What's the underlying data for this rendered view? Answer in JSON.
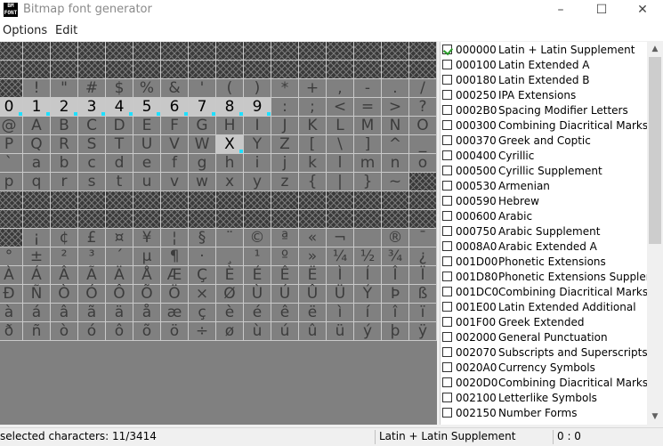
{
  "window": {
    "title": "Bitmap font generator",
    "icon_text": "BM FONT",
    "min_icon": "–",
    "max_icon": "☐",
    "close_icon": "✕"
  },
  "menu": [
    "Options",
    "Edit"
  ],
  "grid": {
    "rows": [
      [
        "",
        "",
        "",
        "",
        "",
        "",
        "",
        "",
        "",
        "",
        "",
        "",
        "",
        "",
        "",
        ""
      ],
      [
        "",
        "",
        "",
        "",
        "",
        "",
        "",
        "",
        "",
        "",
        "",
        "",
        "",
        "",
        "",
        ""
      ],
      [
        "",
        "!",
        "\"",
        "#",
        "$",
        "%",
        "&",
        "'",
        "(",
        ")",
        "*",
        "+",
        ",",
        "-",
        ".",
        "/"
      ],
      [
        "0",
        "1",
        "2",
        "3",
        "4",
        "5",
        "6",
        "7",
        "8",
        "9",
        ":",
        ";",
        "<",
        "=",
        ">",
        "?"
      ],
      [
        "@",
        "A",
        "B",
        "C",
        "D",
        "E",
        "F",
        "G",
        "H",
        "I",
        "J",
        "K",
        "L",
        "M",
        "N",
        "O"
      ],
      [
        "P",
        "Q",
        "R",
        "S",
        "T",
        "U",
        "V",
        "W",
        "X",
        "Y",
        "Z",
        "[",
        "\\",
        "]",
        "^",
        "_"
      ],
      [
        "`",
        "a",
        "b",
        "c",
        "d",
        "e",
        "f",
        "g",
        "h",
        "i",
        "j",
        "k",
        "l",
        "m",
        "n",
        "o"
      ],
      [
        "p",
        "q",
        "r",
        "s",
        "t",
        "u",
        "v",
        "w",
        "x",
        "y",
        "z",
        "{",
        "|",
        "}",
        "~",
        ""
      ],
      [
        "",
        "",
        "",
        "",
        "",
        "",
        "",
        "",
        "",
        "",
        "",
        "",
        "",
        "",
        "",
        ""
      ],
      [
        "",
        "",
        "",
        "",
        "",
        "",
        "",
        "",
        "",
        "",
        "",
        "",
        "",
        "",
        "",
        ""
      ],
      [
        "",
        "¡",
        "¢",
        "£",
        "¤",
        "¥",
        "¦",
        "§",
        "¨",
        "©",
        "ª",
        "«",
        "¬",
        "",
        "®",
        "¯"
      ],
      [
        "°",
        "±",
        "²",
        "³",
        "´",
        "µ",
        "¶",
        "·",
        "¸",
        "¹",
        "º",
        "»",
        "¼",
        "½",
        "¾",
        "¿"
      ],
      [
        "À",
        "Á",
        "Â",
        "Ã",
        "Ä",
        "Å",
        "Æ",
        "Ç",
        "È",
        "É",
        "Ê",
        "Ë",
        "Ì",
        "Í",
        "Î",
        "Ï"
      ],
      [
        "Ð",
        "Ñ",
        "Ò",
        "Ó",
        "Ô",
        "Õ",
        "Ö",
        "×",
        "Ø",
        "Ù",
        "Ú",
        "Û",
        "Ü",
        "Ý",
        "Þ",
        "ß"
      ],
      [
        "à",
        "á",
        "â",
        "ã",
        "ä",
        "å",
        "æ",
        "ç",
        "è",
        "é",
        "ê",
        "ë",
        "ì",
        "í",
        "î",
        "ï"
      ],
      [
        "ð",
        "ñ",
        "ò",
        "ó",
        "ô",
        "õ",
        "ö",
        "÷",
        "ø",
        "ù",
        "ú",
        "û",
        "ü",
        "ý",
        "þ",
        "ÿ"
      ]
    ],
    "empty_rows": [
      0,
      1,
      8,
      9
    ],
    "empty_cells": [
      [
        2,
        0
      ],
      [
        7,
        15
      ],
      [
        10,
        0
      ]
    ],
    "selected_cells": [
      [
        3,
        0
      ],
      [
        3,
        1
      ],
      [
        3,
        2
      ],
      [
        3,
        3
      ],
      [
        3,
        4
      ],
      [
        3,
        5
      ],
      [
        3,
        6
      ],
      [
        3,
        7
      ],
      [
        3,
        8
      ],
      [
        3,
        9
      ],
      [
        5,
        8
      ]
    ]
  },
  "blocks": [
    {
      "code": "000000",
      "name": "Latin + Latin Supplement",
      "checked": true
    },
    {
      "code": "000100",
      "name": "Latin Extended A",
      "checked": false
    },
    {
      "code": "000180",
      "name": "Latin Extended B",
      "checked": false
    },
    {
      "code": "000250",
      "name": "IPA Extensions",
      "checked": false
    },
    {
      "code": "0002B0",
      "name": "Spacing Modifier Letters",
      "checked": false
    },
    {
      "code": "000300",
      "name": "Combining Diacritical Marks",
      "checked": false
    },
    {
      "code": "000370",
      "name": "Greek and Coptic",
      "checked": false
    },
    {
      "code": "000400",
      "name": "Cyrillic",
      "checked": false
    },
    {
      "code": "000500",
      "name": "Cyrillic Supplement",
      "checked": false
    },
    {
      "code": "000530",
      "name": "Armenian",
      "checked": false
    },
    {
      "code": "000590",
      "name": "Hebrew",
      "checked": false
    },
    {
      "code": "000600",
      "name": "Arabic",
      "checked": false
    },
    {
      "code": "000750",
      "name": "Arabic Supplement",
      "checked": false
    },
    {
      "code": "0008A0",
      "name": "Arabic Extended A",
      "checked": false
    },
    {
      "code": "001D00",
      "name": "Phonetic Extensions",
      "checked": false
    },
    {
      "code": "001D80",
      "name": "Phonetic Extensions Supplem",
      "checked": false
    },
    {
      "code": "001DC0",
      "name": "Combining Diacritical Marks",
      "checked": false
    },
    {
      "code": "001E00",
      "name": "Latin Extended Additional",
      "checked": false
    },
    {
      "code": "001F00",
      "name": "Greek Extended",
      "checked": false
    },
    {
      "code": "002000",
      "name": "General Punctuation",
      "checked": false
    },
    {
      "code": "002070",
      "name": "Subscripts and Superscripts",
      "checked": false
    },
    {
      "code": "0020A0",
      "name": "Currency Symbols",
      "checked": false
    },
    {
      "code": "0020D0",
      "name": "Combining Diacritical Marks f",
      "checked": false
    },
    {
      "code": "002100",
      "name": "Letterlike Symbols",
      "checked": false
    },
    {
      "code": "002150",
      "name": "Number Forms",
      "checked": false
    }
  ],
  "scrollbar": {
    "up_icon": "▲",
    "down_icon": "▼"
  },
  "status": {
    "selected": "selected characters: 11/3414",
    "block": "Latin + Latin Supplement",
    "coords": "0 : 0"
  }
}
